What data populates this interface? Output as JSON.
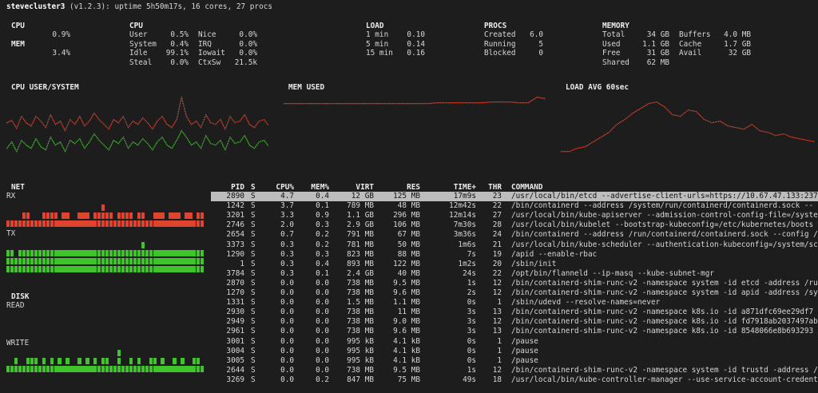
{
  "title": {
    "host": "stevecluster3",
    "rest": " (v1.2.3): uptime 5h50m17s, 16 cores, 27 procs"
  },
  "cpu": {
    "label": "CPU",
    "value": "0.9%",
    "mem_label": "MEM",
    "mem_value": "3.4%"
  },
  "cpu_detail": {
    "heading": "CPU",
    "rows": [
      [
        "User",
        "0.5%",
        "Nice",
        "0.0%"
      ],
      [
        "System",
        "0.4%",
        "IRQ",
        "0.0%"
      ],
      [
        "Idle",
        "99.1%",
        "Iowait",
        "0.0%"
      ],
      [
        "Steal",
        "0.0%",
        "CtxSw",
        "21.5k"
      ]
    ]
  },
  "load": {
    "heading": "LOAD",
    "rows": [
      [
        "1 min",
        "0.10"
      ],
      [
        "5 min",
        "0.14"
      ],
      [
        "15 min",
        "0.16"
      ]
    ]
  },
  "procs": {
    "heading": "PROCS",
    "rows": [
      [
        "Created",
        "6.0"
      ],
      [
        "Running",
        "5"
      ],
      [
        "Blocked",
        "0"
      ]
    ]
  },
  "memory": {
    "heading": "MEMORY",
    "rows": [
      [
        "Total",
        "34 GB",
        "Buffers",
        "4.0 MB"
      ],
      [
        "Used",
        "1.1 GB",
        "Cache",
        "1.7 GB"
      ],
      [
        "Free",
        "31 GB",
        "Avail",
        "32 GB"
      ],
      [
        "Shared",
        "62 MB",
        "",
        ""
      ]
    ]
  },
  "graphs": {
    "cpu_title": "CPU USER/SYSTEM",
    "mem_title": "MEM USED",
    "load_title": "LOAD AVG 60sec"
  },
  "net": {
    "heading": "NET",
    "rx": "RX",
    "tx": "TX"
  },
  "disk": {
    "heading": "DISK",
    "read": "READ",
    "write": "WRITE"
  },
  "colors": {
    "red": "#e0442f",
    "green": "#3fc42b",
    "bg": "#1d1d1d",
    "sel": "#bdbdbd"
  },
  "table": {
    "headers": [
      "PID",
      "S",
      "CPU%",
      "MEM%",
      "VIRT",
      "RES",
      "TIME+",
      "THR",
      "COMMAND"
    ],
    "rows": [
      [
        "2890",
        "S",
        "4.7",
        "0.4",
        "12 GB",
        "125 MB",
        "17m9s",
        "23",
        "/usr/local/bin/etcd --advertise-client-urls=https://10.67.47.133:237"
      ],
      [
        "1242",
        "S",
        "3.7",
        "0.1",
        "789 MB",
        "48 MB",
        "12m42s",
        "22",
        "/bin/containerd --address /system/run/containerd/containerd.sock --"
      ],
      [
        "3201",
        "S",
        "3.3",
        "0.9",
        "1.1 GB",
        "296 MB",
        "12m14s",
        "27",
        "/usr/local/bin/kube-apiserver --admission-control-config-file=/syste"
      ],
      [
        "2746",
        "S",
        "2.0",
        "0.3",
        "2.9 GB",
        "106 MB",
        "7m30s",
        "28",
        "/usr/local/bin/kubelet --bootstrap-kubeconfig=/etc/kubernetes/boots"
      ],
      [
        "2654",
        "S",
        "0.7",
        "0.2",
        "791 MB",
        "67 MB",
        "3m36s",
        "24",
        "/bin/containerd --address /run/containerd/containerd.sock --config /"
      ],
      [
        "3373",
        "S",
        "0.3",
        "0.2",
        "781 MB",
        "50 MB",
        "1m6s",
        "21",
        "/usr/local/bin/kube-scheduler --authentication-kubeconfig=/system/sc"
      ],
      [
        "1290",
        "S",
        "0.3",
        "0.3",
        "823 MB",
        "88 MB",
        "7s",
        "19",
        "/apid --enable-rbac"
      ],
      [
        "1",
        "S",
        "0.3",
        "0.4",
        "893 MB",
        "122 MB",
        "1m2s",
        "20",
        "/sbin/init"
      ],
      [
        "3784",
        "S",
        "0.3",
        "0.1",
        "2.4 GB",
        "40 MB",
        "24s",
        "22",
        "/opt/bin/flanneld --ip-masq --kube-subnet-mgr"
      ],
      [
        "2870",
        "S",
        "0.0",
        "0.0",
        "738 MB",
        "9.5 MB",
        "1s",
        "12",
        "/bin/containerd-shim-runc-v2 -namespace system -id etcd -address /ru"
      ],
      [
        "1270",
        "S",
        "0.0",
        "0.0",
        "738 MB",
        "9.6 MB",
        "2s",
        "12",
        "/bin/containerd-shim-runc-v2 -namespace system -id apid -address /sy"
      ],
      [
        "1331",
        "S",
        "0.0",
        "0.0",
        "1.5 MB",
        "1.1 MB",
        "0s",
        "1",
        "/sbin/udevd --resolve-names=never"
      ],
      [
        "2930",
        "S",
        "0.0",
        "0.0",
        "738 MB",
        "11 MB",
        "3s",
        "13",
        "/bin/containerd-shim-runc-v2 -namespace k8s.io -id a871dfc69ee29df7"
      ],
      [
        "2949",
        "S",
        "0.0",
        "0.0",
        "738 MB",
        "9.0 MB",
        "3s",
        "12",
        "/bin/containerd-shim-runc-v2 -namespace k8s.io -id fd7918ab2037497ab"
      ],
      [
        "2961",
        "S",
        "0.0",
        "0.0",
        "738 MB",
        "9.6 MB",
        "3s",
        "13",
        "/bin/containerd-shim-runc-v2 -namespace k8s.io -id 8548066e8b693293"
      ],
      [
        "3001",
        "S",
        "0.0",
        "0.0",
        "995 kB",
        "4.1 kB",
        "0s",
        "1",
        "/pause"
      ],
      [
        "3004",
        "S",
        "0.0",
        "0.0",
        "995 kB",
        "4.1 kB",
        "0s",
        "1",
        "/pause"
      ],
      [
        "3005",
        "S",
        "0.0",
        "0.0",
        "995 kB",
        "4.1 kB",
        "0s",
        "1",
        "/pause"
      ],
      [
        "2644",
        "S",
        "0.0",
        "0.0",
        "738 MB",
        "9.5 MB",
        "1s",
        "12",
        "/bin/containerd-shim-runc-v2 -namespace system -id trustd -address /"
      ],
      [
        "3269",
        "S",
        "0.0",
        "0.2",
        "847 MB",
        "75 MB",
        "49s",
        "18",
        "/usr/local/bin/kube-controller-manager --use-service-account-credent"
      ]
    ]
  }
}
